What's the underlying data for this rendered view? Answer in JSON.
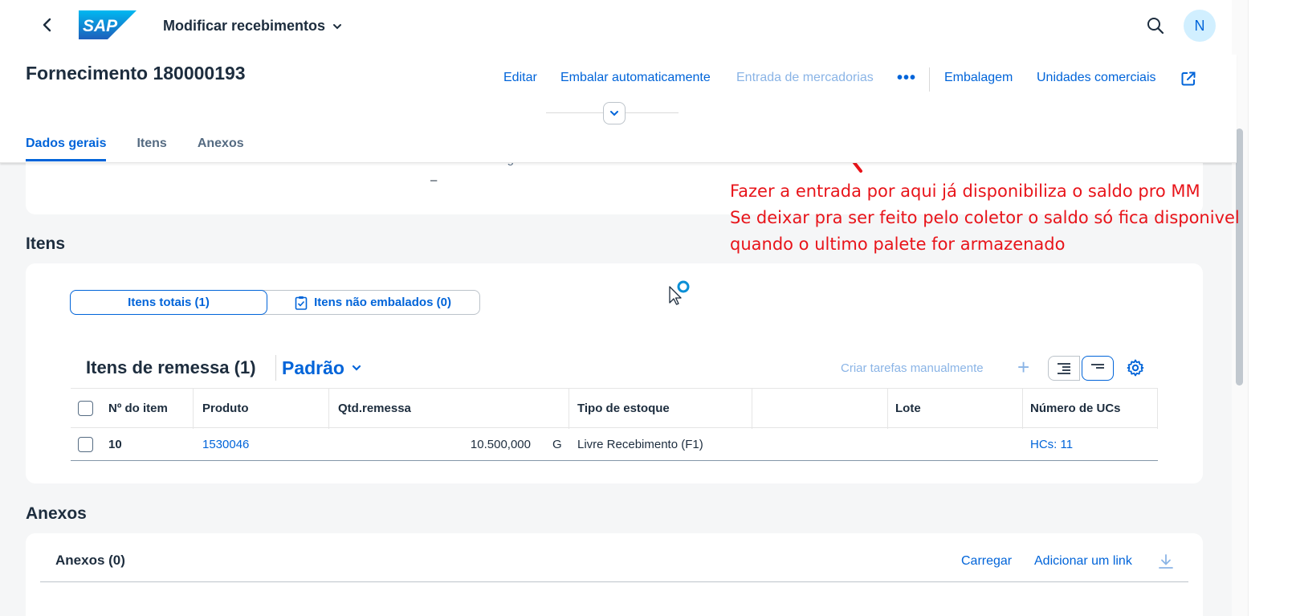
{
  "shell": {
    "back_icon": "chevron-left-icon",
    "logo": "SAP",
    "app_title": "Modificar recebimentos",
    "search_icon": "search-icon",
    "avatar_initial": "N"
  },
  "header": {
    "object_title": "Fornecimento 180000193",
    "actions": {
      "edit": "Editar",
      "auto_pack": "Embalar automaticamente",
      "goods_receipt": "Entrada de mercadorias",
      "more": "•••",
      "packaging": "Embalagem",
      "commercial_units": "Unidades comerciais"
    },
    "tabs": [
      "Dados gerais",
      "Itens",
      "Anexos"
    ]
  },
  "general": {
    "aviso_label": "Aviso de entrega:",
    "aviso_value": "–"
  },
  "items_section": {
    "title": "Itens",
    "segments": {
      "total": "Itens totais (1)",
      "unpacked": "Itens não embalados (0)"
    },
    "table_title": "Itens de remessa (1)",
    "variant": "Padrão",
    "create_tasks": "Criar tarefas manualmente",
    "columns": [
      "Nº do item",
      "Produto",
      "Qtd.remessa",
      "Tipo de estoque",
      "",
      "Lote",
      "Número de UCs"
    ],
    "rows": [
      {
        "item": "10",
        "product": "1530046",
        "qty": "10.500,000",
        "unit": "G",
        "stock_type": "Livre Recebimento (F1)",
        "batch": "",
        "hus": "HCs: 11"
      }
    ]
  },
  "attachments": {
    "section_title": "Anexos",
    "card_title": "Anexos (0)",
    "upload": "Carregar",
    "add_link": "Adicionar um link"
  },
  "annotation": {
    "lines": [
      "Fazer a entrada por aqui já disponibiliza o saldo pro MM",
      "Se deixar pra ser feito pelo coletor o saldo só fica disponivel",
      "quando o ultimo palete for armazenado"
    ],
    "color": "#e8141a"
  },
  "colors": {
    "accent": "#0064d9",
    "text": "#1d2d3e",
    "background": "#f5f6f7"
  }
}
